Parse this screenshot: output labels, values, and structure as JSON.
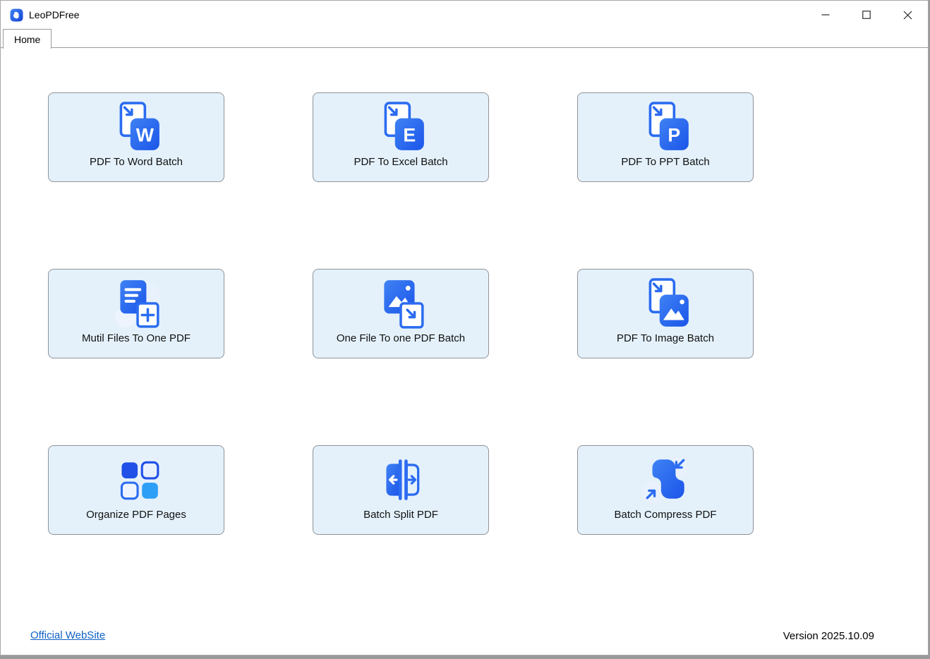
{
  "window": {
    "title": "LeoPDFree",
    "controls": {
      "minimize": "minimize",
      "maximize": "maximize",
      "close": "close"
    }
  },
  "tabs": [
    {
      "label": "Home",
      "active": true
    }
  ],
  "cards": [
    {
      "label": "PDF To Word Batch",
      "icon": "pdf-to-word-batch-icon",
      "letter": "W"
    },
    {
      "label": "PDF To Excel Batch",
      "icon": "pdf-to-excel-batch-icon",
      "letter": "E"
    },
    {
      "label": "PDF To PPT Batch",
      "icon": "pdf-to-ppt-batch-icon",
      "letter": "P"
    },
    {
      "label": "Mutil Files To One PDF",
      "icon": "multi-files-to-one-pdf-icon"
    },
    {
      "label": "One File To one PDF Batch",
      "icon": "one-file-to-one-pdf-batch-icon"
    },
    {
      "label": "PDF To Image Batch",
      "icon": "pdf-to-image-batch-icon"
    },
    {
      "label": "Organize PDF Pages",
      "icon": "organize-pdf-pages-icon"
    },
    {
      "label": "Batch Split PDF",
      "icon": "batch-split-pdf-icon"
    },
    {
      "label": "Batch Compress PDF",
      "icon": "batch-compress-pdf-icon"
    }
  ],
  "footer": {
    "website_link": "Official WebSite",
    "version": "Version 2025.10.09"
  },
  "colors": {
    "card_bg": "#e4f1fb",
    "card_border": "#8f9398",
    "icon_blue": "#2b6cf0",
    "icon_blue_dark": "#1b55e9",
    "icon_blue_light": "#2e9ff7",
    "soft_circle": "#e9f1fc",
    "link_blue": "#0f62c6"
  }
}
